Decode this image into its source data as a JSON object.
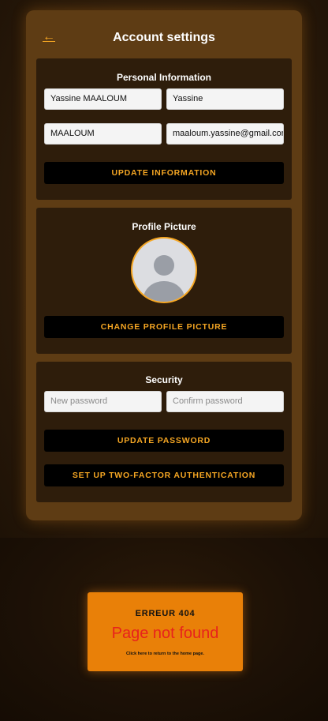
{
  "header": {
    "back_icon": "←",
    "title": "Account settings"
  },
  "personal": {
    "title": "Personal Information",
    "full_name": "Yassine MAALOUM",
    "first_name": "Yassine",
    "last_name": "MAALOUM",
    "email": "maaloum.yassine@gmail.com",
    "update_label": "UPDATE INFORMATION"
  },
  "profile": {
    "title": "Profile Picture",
    "avatar_icon": "default-user-avatar",
    "change_label": "CHANGE PROFILE PICTURE"
  },
  "security": {
    "title": "Security",
    "new_password_placeholder": "New password",
    "confirm_password_placeholder": "Confirm password",
    "update_password_label": "UPDATE PASSWORD",
    "twofa_label": "SET UP TWO-FACTOR AUTHENTICATION"
  },
  "error": {
    "code": "ERREUR 404",
    "message": "Page not found",
    "link": "Click here to return to the home page."
  },
  "colors": {
    "accent": "#f5a623",
    "card": "#5e3c14",
    "section": "#2e1d0b",
    "error_bg": "#e98008",
    "error_text": "#e8221c"
  }
}
